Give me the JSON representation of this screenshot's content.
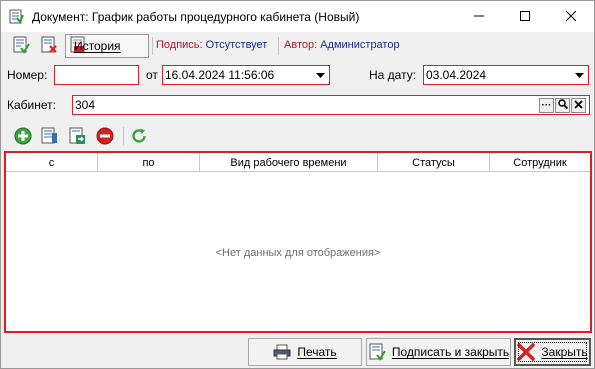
{
  "window": {
    "title": "Документ: График работы процедурного кабинета (Новый)"
  },
  "toolbar": {
    "history_label": "История",
    "signature_key": "Подпись:",
    "signature_value": "Отсутствует",
    "author_key": "Автор:",
    "author_value": "Администратор"
  },
  "form": {
    "number_label": "Номер:",
    "number_value": "",
    "from_label": "от",
    "from_value": "16.04.2024 11:56:06",
    "for_date_label": "На дату:",
    "for_date_value": "03.04.2024",
    "cabinet_label": "Кабинет:",
    "cabinet_value": "304"
  },
  "grid": {
    "columns": [
      "с",
      "по",
      "Вид рабочего времени",
      "Статусы",
      "Сотрудник"
    ],
    "rows": [],
    "empty_text": "<Нет данных для отображения>"
  },
  "footer": {
    "print_label": "Печать",
    "sign_close_label": "Подписать и закрыть",
    "close_label": "Закрыть"
  },
  "colors": {
    "required_border": "#d9202a",
    "status_key": "#b2182b",
    "status_value": "#1a2a8a"
  }
}
